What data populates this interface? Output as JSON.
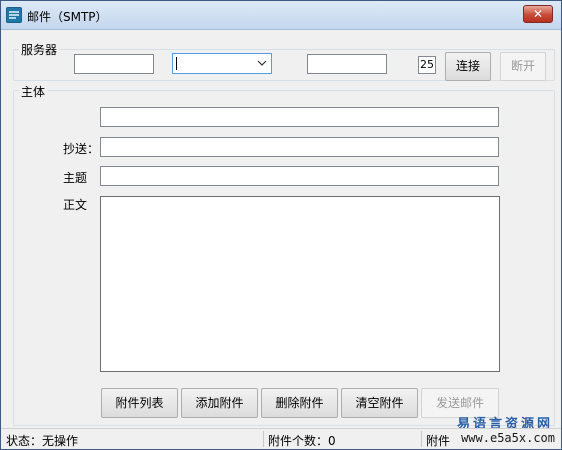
{
  "window": {
    "title": "邮件（SMTP）",
    "close_label": "✕"
  },
  "server_group": {
    "legend": "服务器",
    "host_value": "",
    "combo_value": "",
    "port_field_value": "",
    "port_number": "25",
    "connect_label": "连接",
    "disconnect_label": "断开"
  },
  "body_group": {
    "legend": "主体",
    "to_value": "",
    "cc_label": "抄送：",
    "cc_value": "",
    "subject_label": "主题",
    "subject_value": "",
    "content_label": "正文",
    "content_value": ""
  },
  "buttons": {
    "attachment_list": "附件列表",
    "add_attachment": "添加附件",
    "delete_attachment": "删除附件",
    "clear_attachments": "清空附件",
    "send_mail": "发送邮件"
  },
  "statusbar": {
    "status": "状态：无操作",
    "attachment_count": "附件个数：0",
    "attachment_size": "附件"
  },
  "watermark": {
    "text": "易语言资源网",
    "url": "www.e5a5x.com",
    "color": "#2a5fa8"
  },
  "colors": {
    "titlebar_top": "#dde9f6",
    "close_button": "#c74a38",
    "focus_border": "#569de5"
  }
}
